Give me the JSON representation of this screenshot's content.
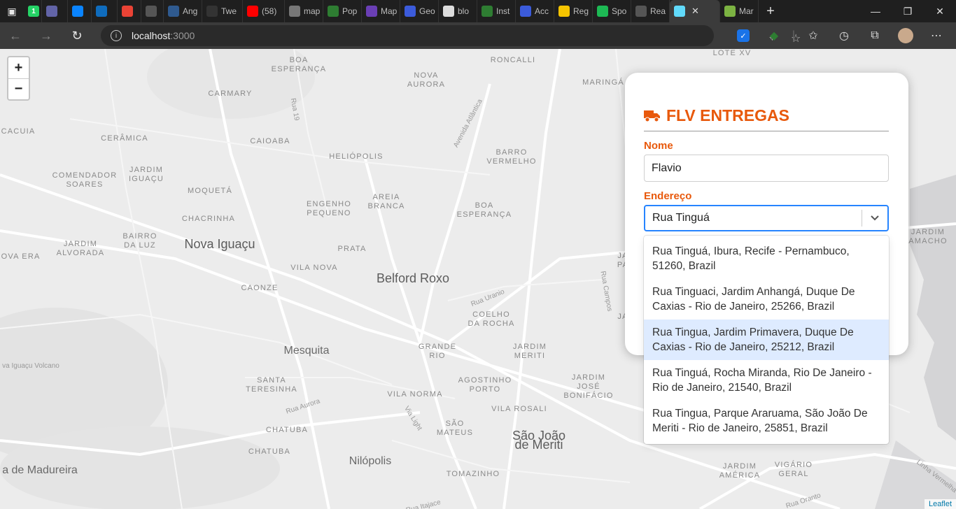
{
  "browser": {
    "tabs": [
      {
        "label": "",
        "icon": "whatsapp-icon",
        "color": "#25d366",
        "badge": "1"
      },
      {
        "label": "",
        "icon": "teams-icon",
        "color": "#6264a7"
      },
      {
        "label": "",
        "icon": "chat-icon",
        "color": "#0a84ff"
      },
      {
        "label": "",
        "icon": "outlook-icon",
        "color": "#0f6cbd"
      },
      {
        "label": "",
        "icon": "gmail-icon",
        "color": "#ea4335"
      },
      {
        "label": "",
        "icon": "page-icon",
        "color": "#555555"
      },
      {
        "label": "Ang",
        "icon": "a-icon",
        "color": "#2f5a8f"
      },
      {
        "label": "Twe",
        "icon": "medium-icon",
        "color": "#333333"
      },
      {
        "label": "(58)",
        "icon": "youtube-icon",
        "color": "#ff0000"
      },
      {
        "label": "map",
        "icon": "globe-icon",
        "color": "#777777"
      },
      {
        "label": "Pop",
        "icon": "leaf-icon",
        "color": "#2e7d32"
      },
      {
        "label": "Map",
        "icon": "pen-icon",
        "color": "#6a3fb5"
      },
      {
        "label": "Geo",
        "icon": "geo-icon",
        "color": "#3b5bdb"
      },
      {
        "label": "blo",
        "icon": "github-icon",
        "color": "#dddddd"
      },
      {
        "label": "Inst",
        "icon": "leaf-icon",
        "color": "#2e7d32"
      },
      {
        "label": "Acc",
        "icon": "geo-icon",
        "color": "#3b5bdb"
      },
      {
        "label": "Reg",
        "icon": "clock-icon",
        "color": "#f5c400"
      },
      {
        "label": "Spo",
        "icon": "spotify-icon",
        "color": "#1db954"
      },
      {
        "label": "Rea",
        "icon": "page-icon",
        "color": "#555555"
      },
      {
        "label": "",
        "icon": "react-icon",
        "color": "#61dafb",
        "active": true
      },
      {
        "label": "Mar",
        "icon": "leaf-icon",
        "color": "#7cb342"
      }
    ],
    "url_host": "localhost",
    "url_port": ":3000"
  },
  "map": {
    "zoom_in": "+",
    "zoom_out": "−",
    "attribution": "Leaflet",
    "labels": [
      {
        "t": "BOA\nESPERANÇA",
        "c": ""
      },
      {
        "t": "RONCALLI",
        "c": ""
      },
      {
        "t": "NOVA\nAURORA",
        "c": ""
      },
      {
        "t": "CARMARY",
        "c": ""
      },
      {
        "t": "MARINGÁ",
        "c": ""
      },
      {
        "t": "LOTE XV",
        "c": ""
      },
      {
        "t": "CACUIA",
        "c": ""
      },
      {
        "t": "CERÂMICA",
        "c": ""
      },
      {
        "t": "CAIOABA",
        "c": ""
      },
      {
        "t": "HELIÓPOLIS",
        "c": ""
      },
      {
        "t": "BARRO\nVERMELHO",
        "c": ""
      },
      {
        "t": "COMENDADOR\nSOARES",
        "c": ""
      },
      {
        "t": "JARDIM\nIGUAÇU",
        "c": ""
      },
      {
        "t": "MOQUETÁ",
        "c": ""
      },
      {
        "t": "ENGENHO\nPEQUENO",
        "c": ""
      },
      {
        "t": "AREIA\nBRANCA",
        "c": ""
      },
      {
        "t": "BOA\nESPERANÇA",
        "c": ""
      },
      {
        "t": "CHACRINHA",
        "c": ""
      },
      {
        "t": "BAIRRO\nDA LUZ",
        "c": ""
      },
      {
        "t": "JARDIM\nALVORADA",
        "c": ""
      },
      {
        "t": "NOVA ERA",
        "c": ""
      },
      {
        "t": "Nova Iguaçu",
        "c": "city"
      },
      {
        "t": "PRATA",
        "c": ""
      },
      {
        "t": "VILA NOVA",
        "c": ""
      },
      {
        "t": "Belford Roxo",
        "c": "city"
      },
      {
        "t": "CAONZE",
        "c": ""
      },
      {
        "t": "COELHO\nDA ROCHA",
        "c": ""
      },
      {
        "t": "Mesquita",
        "c": "city-sm"
      },
      {
        "t": "GRANDE\nRIO",
        "c": ""
      },
      {
        "t": "JARDIM\nMERITI",
        "c": ""
      },
      {
        "t": "va Iguaçu Volcano",
        "c": "road"
      },
      {
        "t": "SANTA\nTERESINHA",
        "c": ""
      },
      {
        "t": "AGOSTINHO\nPORTO",
        "c": ""
      },
      {
        "t": "JARDIM\nJOSÉ\nBONIFÁCIO",
        "c": ""
      },
      {
        "t": "VILA NORMA",
        "c": ""
      },
      {
        "t": "VILA ROSALI",
        "c": ""
      },
      {
        "t": "CHATUBA",
        "c": ""
      },
      {
        "t": "SÃO\nMATEUS",
        "c": ""
      },
      {
        "t": "São João\nde Meriti",
        "c": "city"
      },
      {
        "t": "CHATUBA",
        "c": ""
      },
      {
        "t": "Nilópolis",
        "c": "city-sm"
      },
      {
        "t": "a de Madureira",
        "c": "city-sm"
      },
      {
        "t": "TOMAZINHO",
        "c": ""
      },
      {
        "t": "JARDIM\nAMÉRICA",
        "c": ""
      },
      {
        "t": "VIGÁRIO\nGERAL",
        "c": ""
      },
      {
        "t": "JARDIM\nAMACHO",
        "c": ""
      },
      {
        "t": "Rua 19",
        "c": "road"
      },
      {
        "t": "Avenida Atlântica",
        "c": "road"
      },
      {
        "t": "Rua Uranio",
        "c": "road"
      },
      {
        "t": "Rua Campos",
        "c": "road"
      },
      {
        "t": "Rua Aurora",
        "c": "road"
      },
      {
        "t": "Via Light",
        "c": "road"
      },
      {
        "t": "Rua Itajace",
        "c": "road"
      },
      {
        "t": "Rua Oranto",
        "c": "road"
      },
      {
        "t": "Linha Vermelha",
        "c": "road"
      },
      {
        "t": "JA",
        "c": ""
      },
      {
        "t": "JA\nPA",
        "c": ""
      }
    ]
  },
  "panel": {
    "brand": "FLV ENTREGAS",
    "name_label": "Nome",
    "name_value": "Flavio",
    "address_label": "Endereço",
    "address_value": "Rua Tinguá",
    "options": [
      {
        "text": "Rua Tinguá, Ibura, Recife - Pernambuco, 51260, Brazil",
        "highlighted": false
      },
      {
        "text": "Rua Tinguaci, Jardim Anhangá, Duque De Caxias - Rio de Janeiro, 25266, Brazil",
        "highlighted": false
      },
      {
        "text": "Rua Tingua, Jardim Primavera, Duque De Caxias - Rio de Janeiro, 25212, Brazil",
        "highlighted": true
      },
      {
        "text": "Rua Tinguá, Rocha Miranda, Rio De Janeiro - Rio de Janeiro, 21540, Brazil",
        "highlighted": false
      },
      {
        "text": "Rua Tingua, Parque Araruama, São João De Meriti - Rio de Janeiro, 25851, Brazil",
        "highlighted": false
      }
    ],
    "accent_color": "#e8590c",
    "focus_color": "#2684ff",
    "highlight_color": "#deebff"
  }
}
